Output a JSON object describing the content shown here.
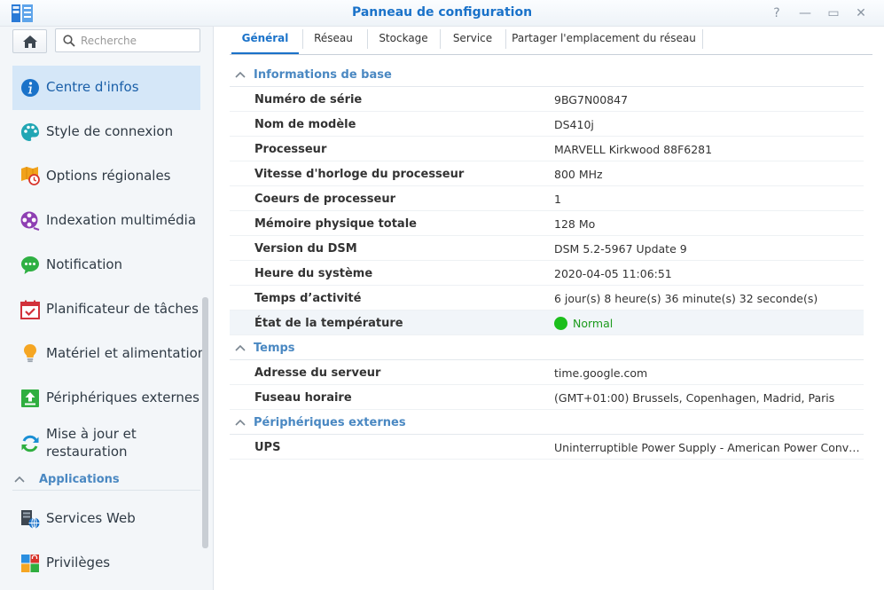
{
  "window": {
    "title": "Panneau de configuration",
    "controls": {
      "help": "?",
      "minimize": "—",
      "maximize": "▭",
      "close": "✕"
    }
  },
  "search": {
    "placeholder": "Recherche",
    "value": ""
  },
  "sidebar": {
    "items": [
      {
        "label": "Centre d'infos",
        "icon": "info-icon",
        "active": true
      },
      {
        "label": "Style de connexion",
        "icon": "palette-icon"
      },
      {
        "label": "Options régionales",
        "icon": "map-clock-icon"
      },
      {
        "label": "Indexation multimédia",
        "icon": "film-reel-icon"
      },
      {
        "label": "Notification",
        "icon": "chat-bubble-icon"
      },
      {
        "label": "Planificateur de tâches",
        "icon": "calendar-check-icon"
      },
      {
        "label": "Matériel et alimentation",
        "icon": "lightbulb-icon"
      },
      {
        "label": "Périphériques externes",
        "icon": "upload-icon"
      },
      {
        "label": "Mise à jour et restauration",
        "icon": "refresh-icon"
      }
    ],
    "group": "Applications",
    "app_items": [
      {
        "label": "Services Web",
        "icon": "web-services-icon"
      },
      {
        "label": "Privilèges",
        "icon": "privileges-icon"
      }
    ]
  },
  "tabs": [
    {
      "label": "Général",
      "active": true
    },
    {
      "label": "Réseau"
    },
    {
      "label": "Stockage"
    },
    {
      "label": "Service"
    },
    {
      "label": "Partager l'emplacement du réseau"
    }
  ],
  "sections": {
    "basic": {
      "title": "Informations de base",
      "rows": [
        {
          "key": "Numéro de série",
          "value": "9BG7N00847"
        },
        {
          "key": "Nom de modèle",
          "value": "DS410j"
        },
        {
          "key": "Processeur",
          "value": "MARVELL Kirkwood 88F6281"
        },
        {
          "key": "Vitesse d'horloge du processeur",
          "value": "800 MHz"
        },
        {
          "key": "Coeurs de processeur",
          "value": "1"
        },
        {
          "key": "Mémoire physique totale",
          "value": "128 Mo"
        },
        {
          "key": "Version du DSM",
          "value": "DSM 5.2-5967 Update 9"
        },
        {
          "key": "Heure du système",
          "value": "2020-04-05 11:06:51"
        },
        {
          "key": "Temps d’activité",
          "value": "6 jour(s) 8 heure(s) 36 minute(s) 32 seconde(s)"
        },
        {
          "key": "État de la température",
          "value": "Normal"
        }
      ]
    },
    "time": {
      "title": "Temps",
      "rows": [
        {
          "key": "Adresse du serveur",
          "value": "time.google.com"
        },
        {
          "key": "Fuseau horaire",
          "value": "(GMT+01:00) Brussels, Copenhagen, Madrid, Paris"
        }
      ]
    },
    "external": {
      "title": "Périphériques externes",
      "rows": [
        {
          "key": "UPS",
          "value": "Uninterruptible Power Supply - American Power Conver..."
        }
      ]
    }
  },
  "colors": {
    "accent": "#1a72c9",
    "group": "#4a88c2",
    "status_ok": "#1cbf1c",
    "active_bg": "#d5e7f8"
  }
}
